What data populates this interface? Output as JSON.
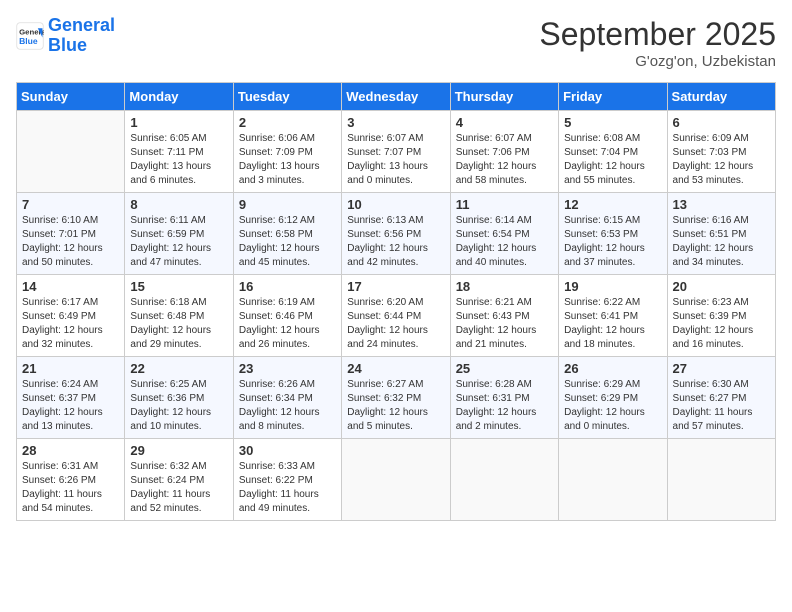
{
  "logo": {
    "line1": "General",
    "line2": "Blue"
  },
  "title": "September 2025",
  "subtitle": "G'ozg'on, Uzbekistan",
  "days_of_week": [
    "Sunday",
    "Monday",
    "Tuesday",
    "Wednesday",
    "Thursday",
    "Friday",
    "Saturday"
  ],
  "weeks": [
    [
      {
        "day": "",
        "info": ""
      },
      {
        "day": "1",
        "info": "Sunrise: 6:05 AM\nSunset: 7:11 PM\nDaylight: 13 hours\nand 6 minutes."
      },
      {
        "day": "2",
        "info": "Sunrise: 6:06 AM\nSunset: 7:09 PM\nDaylight: 13 hours\nand 3 minutes."
      },
      {
        "day": "3",
        "info": "Sunrise: 6:07 AM\nSunset: 7:07 PM\nDaylight: 13 hours\nand 0 minutes."
      },
      {
        "day": "4",
        "info": "Sunrise: 6:07 AM\nSunset: 7:06 PM\nDaylight: 12 hours\nand 58 minutes."
      },
      {
        "day": "5",
        "info": "Sunrise: 6:08 AM\nSunset: 7:04 PM\nDaylight: 12 hours\nand 55 minutes."
      },
      {
        "day": "6",
        "info": "Sunrise: 6:09 AM\nSunset: 7:03 PM\nDaylight: 12 hours\nand 53 minutes."
      }
    ],
    [
      {
        "day": "7",
        "info": "Sunrise: 6:10 AM\nSunset: 7:01 PM\nDaylight: 12 hours\nand 50 minutes."
      },
      {
        "day": "8",
        "info": "Sunrise: 6:11 AM\nSunset: 6:59 PM\nDaylight: 12 hours\nand 47 minutes."
      },
      {
        "day": "9",
        "info": "Sunrise: 6:12 AM\nSunset: 6:58 PM\nDaylight: 12 hours\nand 45 minutes."
      },
      {
        "day": "10",
        "info": "Sunrise: 6:13 AM\nSunset: 6:56 PM\nDaylight: 12 hours\nand 42 minutes."
      },
      {
        "day": "11",
        "info": "Sunrise: 6:14 AM\nSunset: 6:54 PM\nDaylight: 12 hours\nand 40 minutes."
      },
      {
        "day": "12",
        "info": "Sunrise: 6:15 AM\nSunset: 6:53 PM\nDaylight: 12 hours\nand 37 minutes."
      },
      {
        "day": "13",
        "info": "Sunrise: 6:16 AM\nSunset: 6:51 PM\nDaylight: 12 hours\nand 34 minutes."
      }
    ],
    [
      {
        "day": "14",
        "info": "Sunrise: 6:17 AM\nSunset: 6:49 PM\nDaylight: 12 hours\nand 32 minutes."
      },
      {
        "day": "15",
        "info": "Sunrise: 6:18 AM\nSunset: 6:48 PM\nDaylight: 12 hours\nand 29 minutes."
      },
      {
        "day": "16",
        "info": "Sunrise: 6:19 AM\nSunset: 6:46 PM\nDaylight: 12 hours\nand 26 minutes."
      },
      {
        "day": "17",
        "info": "Sunrise: 6:20 AM\nSunset: 6:44 PM\nDaylight: 12 hours\nand 24 minutes."
      },
      {
        "day": "18",
        "info": "Sunrise: 6:21 AM\nSunset: 6:43 PM\nDaylight: 12 hours\nand 21 minutes."
      },
      {
        "day": "19",
        "info": "Sunrise: 6:22 AM\nSunset: 6:41 PM\nDaylight: 12 hours\nand 18 minutes."
      },
      {
        "day": "20",
        "info": "Sunrise: 6:23 AM\nSunset: 6:39 PM\nDaylight: 12 hours\nand 16 minutes."
      }
    ],
    [
      {
        "day": "21",
        "info": "Sunrise: 6:24 AM\nSunset: 6:37 PM\nDaylight: 12 hours\nand 13 minutes."
      },
      {
        "day": "22",
        "info": "Sunrise: 6:25 AM\nSunset: 6:36 PM\nDaylight: 12 hours\nand 10 minutes."
      },
      {
        "day": "23",
        "info": "Sunrise: 6:26 AM\nSunset: 6:34 PM\nDaylight: 12 hours\nand 8 minutes."
      },
      {
        "day": "24",
        "info": "Sunrise: 6:27 AM\nSunset: 6:32 PM\nDaylight: 12 hours\nand 5 minutes."
      },
      {
        "day": "25",
        "info": "Sunrise: 6:28 AM\nSunset: 6:31 PM\nDaylight: 12 hours\nand 2 minutes."
      },
      {
        "day": "26",
        "info": "Sunrise: 6:29 AM\nSunset: 6:29 PM\nDaylight: 12 hours\nand 0 minutes."
      },
      {
        "day": "27",
        "info": "Sunrise: 6:30 AM\nSunset: 6:27 PM\nDaylight: 11 hours\nand 57 minutes."
      }
    ],
    [
      {
        "day": "28",
        "info": "Sunrise: 6:31 AM\nSunset: 6:26 PM\nDaylight: 11 hours\nand 54 minutes."
      },
      {
        "day": "29",
        "info": "Sunrise: 6:32 AM\nSunset: 6:24 PM\nDaylight: 11 hours\nand 52 minutes."
      },
      {
        "day": "30",
        "info": "Sunrise: 6:33 AM\nSunset: 6:22 PM\nDaylight: 11 hours\nand 49 minutes."
      },
      {
        "day": "",
        "info": ""
      },
      {
        "day": "",
        "info": ""
      },
      {
        "day": "",
        "info": ""
      },
      {
        "day": "",
        "info": ""
      }
    ]
  ]
}
